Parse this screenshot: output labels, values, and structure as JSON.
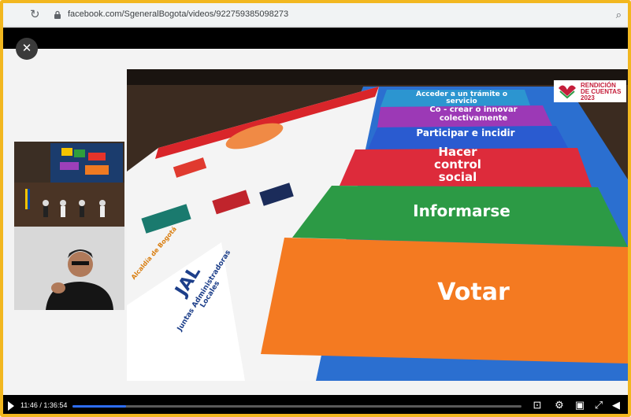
{
  "browser": {
    "url": "facebook.com/SgeneralBogota/videos/922759385098273"
  },
  "video": {
    "mats": {
      "acceder": "Acceder a un trámite o servicio",
      "co_crear": "Co - crear o innovar colectivamente",
      "participar": "Participar e incidir",
      "hacer_control": "Hacer control social",
      "informarse": "Informarse",
      "votar": "Votar"
    },
    "banner": {
      "jal": "JAL",
      "jal_full": "Juntas Administradoras Locales",
      "alcaldia": "Alcaldía de Bogotá"
    },
    "logo": {
      "line1": "RENDICIÓN",
      "line2": "DE CUENTAS 2023"
    }
  },
  "player": {
    "time": "11:46 / 1:36:54",
    "progress": 0.12
  }
}
